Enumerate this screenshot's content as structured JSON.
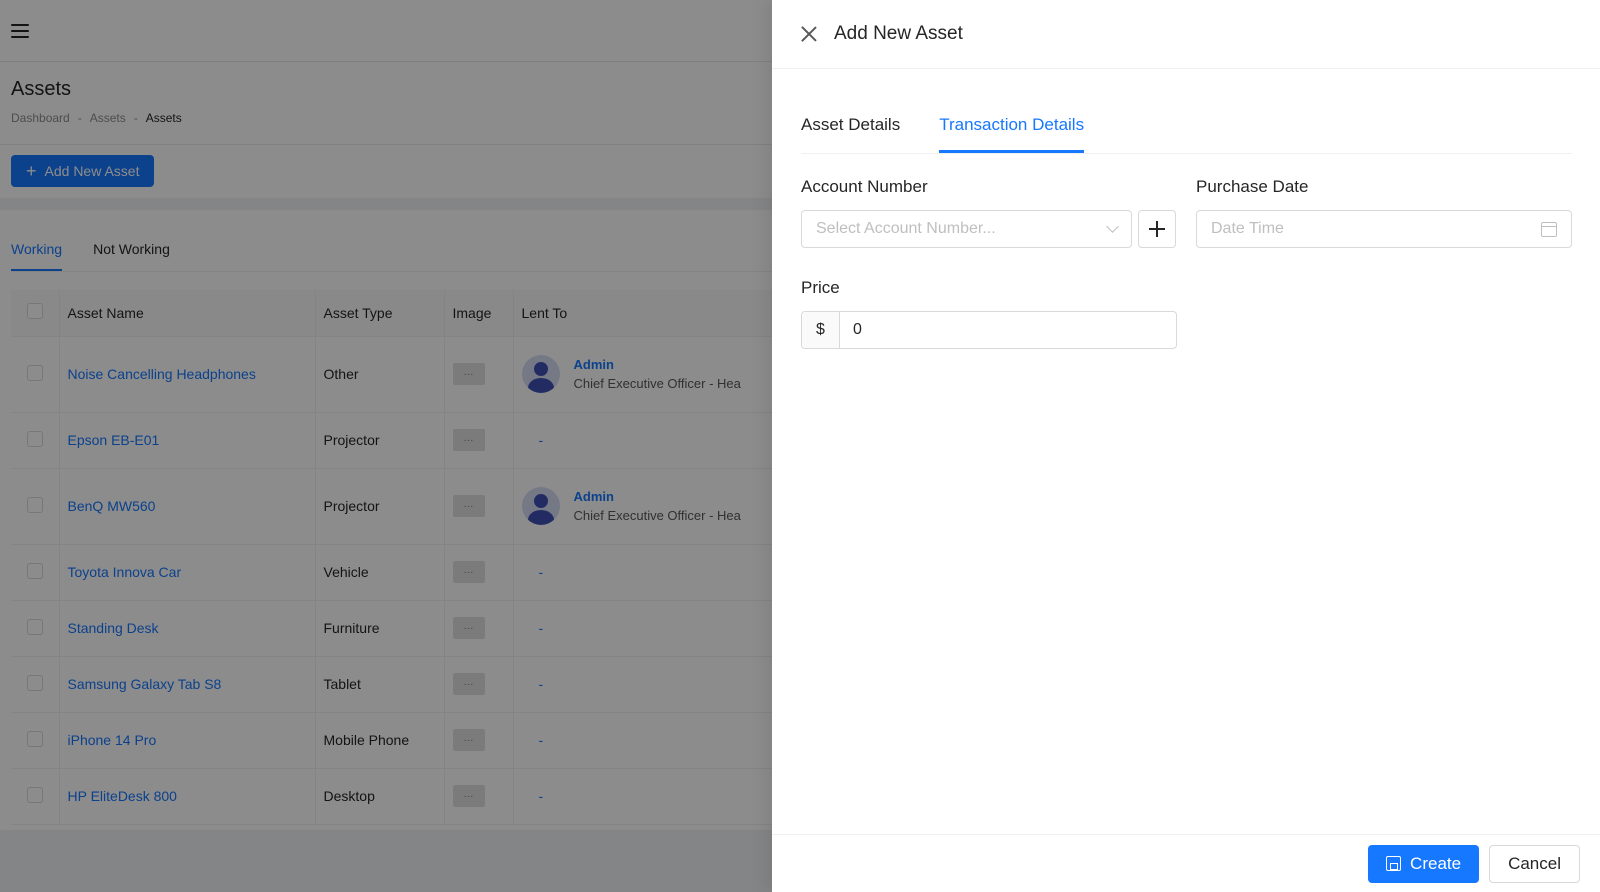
{
  "page": {
    "title": "Assets",
    "breadcrumb": [
      "Dashboard",
      "Assets",
      "Assets"
    ],
    "breadcrumb_sep": "-",
    "add_button": "Add New Asset",
    "tabs": [
      "Working",
      "Not Working"
    ],
    "columns": [
      "Asset Name",
      "Asset Type",
      "Image",
      "Lent To"
    ],
    "rows": [
      {
        "name": "Noise Cancelling Headphones",
        "type": "Other",
        "image": "···",
        "lent_name": "Admin",
        "lent_role": "Chief Executive Officer - Hea"
      },
      {
        "name": "Epson EB-E01",
        "type": "Projector",
        "image": "···",
        "lent": "-"
      },
      {
        "name": "BenQ MW560",
        "type": "Projector",
        "image": "···",
        "lent_name": "Admin",
        "lent_role": "Chief Executive Officer - Hea"
      },
      {
        "name": "Toyota Innova Car",
        "type": "Vehicle",
        "image": "···",
        "lent": "-"
      },
      {
        "name": "Standing Desk",
        "type": "Furniture",
        "image": "···",
        "lent": "-"
      },
      {
        "name": "Samsung Galaxy Tab S8",
        "type": "Tablet",
        "image": "···",
        "lent": "-"
      },
      {
        "name": "iPhone 14 Pro",
        "type": "Mobile Phone",
        "image": "···",
        "lent": "-"
      },
      {
        "name": "HP EliteDesk 800",
        "type": "Desktop",
        "image": "···",
        "lent": "-"
      }
    ]
  },
  "drawer": {
    "title": "Add New Asset",
    "tabs": [
      "Asset Details",
      "Transaction Details"
    ],
    "active_tab": "Transaction Details",
    "account_number": {
      "label": "Account Number",
      "placeholder": "Select Account Number..."
    },
    "purchase_date": {
      "label": "Purchase Date",
      "placeholder": "Date Time"
    },
    "price": {
      "label": "Price",
      "prefix": "$",
      "value": "0"
    },
    "create_label": "Create",
    "cancel_label": "Cancel"
  },
  "icons": {
    "menu": "menu-icon",
    "close": "close-icon",
    "calendar": "calendar-icon",
    "save": "save-icon"
  },
  "colors": {
    "primary": "#1677ff",
    "overlay": "rgba(0,0,0,0.45)"
  }
}
